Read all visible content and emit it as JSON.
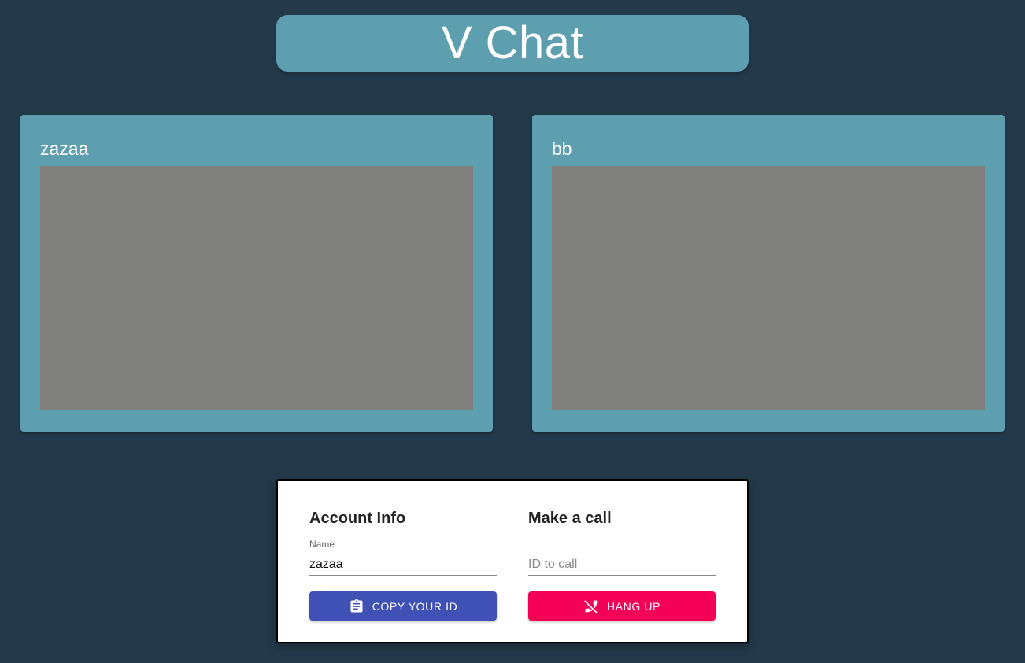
{
  "app": {
    "title": "V Chat"
  },
  "videos": [
    {
      "name": "zazaa"
    },
    {
      "name": "bb"
    }
  ],
  "account": {
    "heading": "Account Info",
    "name_label": "Name",
    "name_value": "zazaa",
    "copy_button_label": "COPY YOUR ID",
    "copy_icon": "clipboard-icon"
  },
  "call": {
    "heading": "Make a call",
    "id_placeholder": "ID to call",
    "id_value": "",
    "hangup_button_label": "HANG UP",
    "hangup_icon": "phone-disabled-icon"
  },
  "colors": {
    "background": "#243a4a",
    "card": "#5d9eaf",
    "video_placeholder": "#80817e",
    "primary": "#3f51b5",
    "secondary": "#f50057"
  }
}
